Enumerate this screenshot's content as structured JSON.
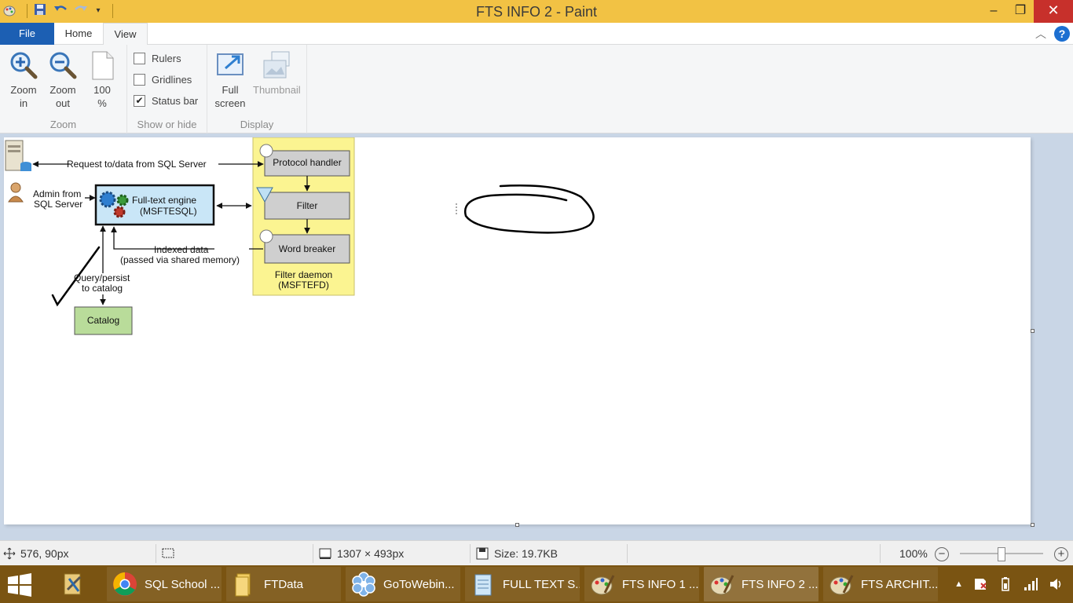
{
  "window": {
    "title": "FTS INFO 2 - Paint"
  },
  "qat": {
    "icons": [
      "paint-menu-icon",
      "save-icon",
      "undo-icon",
      "redo-icon",
      "customize-qat-icon"
    ]
  },
  "window_controls": {
    "minimize": "–",
    "maximize": "❐",
    "close": "✕"
  },
  "tabs": {
    "file": "File",
    "home": "Home",
    "view": "View"
  },
  "ribbon": {
    "zoom": {
      "label": "Zoom",
      "zoom_in_line1": "Zoom",
      "zoom_in_line2": "in",
      "zoom_out_line1": "Zoom",
      "zoom_out_line2": "out",
      "hundred_line1": "100",
      "hundred_line2": "%"
    },
    "show": {
      "label": "Show or hide",
      "rulers": "Rulers",
      "rulers_checked": false,
      "gridlines": "Gridlines",
      "gridlines_checked": false,
      "statusbar": "Status bar",
      "statusbar_checked": true,
      "check_glyph": "✔"
    },
    "display": {
      "label": "Display",
      "full_line1": "Full",
      "full_line2": "screen",
      "thumbnail": "Thumbnail"
    }
  },
  "diagram": {
    "request": "Request to/data from SQL Server",
    "admin_line1": "Admin from",
    "admin_line2": "SQL Server",
    "engine_line1": "Full-text engine",
    "engine_line2": "(MSFTESQL)",
    "protocol": "Protocol handler",
    "filter": "Filter",
    "wordbreaker": "Word breaker",
    "daemon_line1": "Filter daemon",
    "daemon_line2": "(MSFTEFD)",
    "indexed_line1": "Indexed data",
    "indexed_line2": "(passed via shared memory)",
    "query_line1": "Query/persist",
    "query_line2": "to catalog",
    "catalog": "Catalog"
  },
  "statusbar": {
    "cursor": "576, 90px",
    "dimensions": "1307 × 493px",
    "size": "Size: 19.7KB",
    "zoom": "100%",
    "zoom_level": 1.0
  },
  "taskbar": {
    "items": [
      {
        "label": "SQL School ...",
        "icon": "chrome-icon"
      },
      {
        "label": "FTData",
        "icon": "folder-icon"
      },
      {
        "label": "GoToWebin...",
        "icon": "gotowebinar-icon"
      },
      {
        "label": "FULL TEXT S...",
        "icon": "notepad-icon"
      },
      {
        "label": "FTS INFO 1 ...",
        "icon": "paint-icon"
      },
      {
        "label": "FTS INFO 2 ...",
        "icon": "paint-icon"
      },
      {
        "label": "FTS ARCHIT...",
        "icon": "paint-icon"
      }
    ]
  },
  "colors": {
    "titlebar": "#f2c244",
    "file_tab": "#1c5fb3",
    "close": "#c7302b",
    "taskbar": "#7a5412",
    "daemon_bg": "#fbf491",
    "engine_bg": "#c9e6f7",
    "catalog_bg": "#b9dc9a"
  }
}
